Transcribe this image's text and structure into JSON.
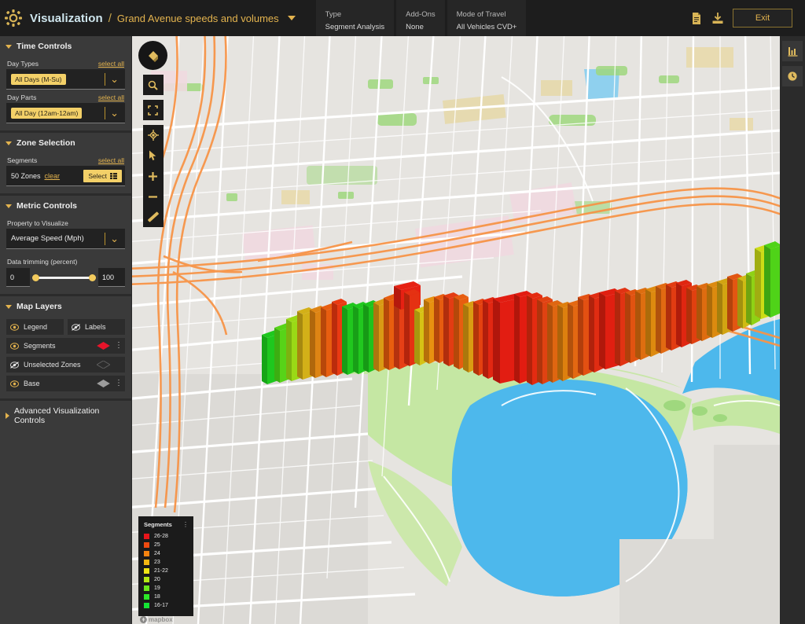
{
  "header": {
    "logo_icon": "gear-burst-logo",
    "app_title": "Visualization",
    "separator": "/",
    "project_name": "Grand Avenue speeds and volumes",
    "project_caret_icon": "chevron-down-icon",
    "chips": [
      {
        "key": "Type",
        "value": "Segment Analysis"
      },
      {
        "key": "Add-Ons",
        "value": "None"
      },
      {
        "key": "Mode of Travel",
        "value": "All Vehicles CVD+"
      }
    ],
    "report_icon": "document-icon",
    "download_icon": "download-icon",
    "exit_label": "Exit"
  },
  "sidebar": {
    "time_controls": {
      "title": "Time Controls",
      "expanded": true,
      "day_types": {
        "label": "Day Types",
        "select_all": "select all",
        "value": "All Days (M-Su)",
        "chevron_icon": "chevron-down-icon"
      },
      "day_parts": {
        "label": "Day Parts",
        "select_all": "select all",
        "value": "All Day (12am-12am)",
        "chevron_icon": "chevron-down-icon"
      }
    },
    "zone_selection": {
      "title": "Zone Selection",
      "expanded": true,
      "segments_label": "Segments",
      "select_all": "select all",
      "zone_count": "50 Zones",
      "clear_label": "clear",
      "select_button": "Select",
      "select_button_icon": "grid-icon"
    },
    "metric_controls": {
      "title": "Metric Controls",
      "expanded": true,
      "property_label": "Property to Visualize",
      "property_value": "Average Speed (Mph)",
      "chevron_icon": "chevron-down-icon",
      "trimming_label": "Data trimming (percent)",
      "trim_min": "0",
      "trim_max": "100"
    },
    "map_layers": {
      "title": "Map Layers",
      "expanded": true,
      "rows": [
        {
          "label": "Legend",
          "visible": true,
          "eye_icon": "eye-icon",
          "shape": "none",
          "menu": false
        },
        {
          "label": "Labels",
          "visible": false,
          "eye_icon": "eye-off-icon",
          "shape": "none",
          "menu": false
        },
        {
          "label": "Segments",
          "visible": true,
          "eye_icon": "eye-icon",
          "shape": "diamond",
          "shape_color": "#e8142a",
          "menu": true
        },
        {
          "label": "Unselected Zones",
          "visible": false,
          "eye_icon": "eye-off-icon",
          "shape": "diamond",
          "shape_color": "#4a4a4a",
          "menu": false
        },
        {
          "label": "Base",
          "visible": true,
          "eye_icon": "eye-icon",
          "shape": "diamond",
          "shape_color": "#9d9d9d",
          "menu": true
        }
      ]
    },
    "advanced": {
      "title": "Advanced Visualization Controls",
      "expanded": false
    }
  },
  "map": {
    "tools": [
      {
        "name": "paint-bucket-tool",
        "icon": "bucket-icon"
      },
      {
        "name": "search-tool",
        "icon": "search-icon"
      },
      {
        "name": "fullscreen-tool",
        "icon": "expand-icon"
      },
      {
        "name": "recenter-tool",
        "icon": "crosshair-icon"
      },
      {
        "name": "pointer-tool",
        "icon": "cursor-icon"
      },
      {
        "name": "zoom-in-tool",
        "icon": "plus-icon"
      },
      {
        "name": "zoom-out-tool",
        "icon": "minus-icon"
      },
      {
        "name": "measure-tool",
        "icon": "ruler-icon"
      }
    ],
    "attribution": "mapbox"
  },
  "legend": {
    "title": "Segments",
    "menu_icon": "kebab-menu-icon",
    "items": [
      {
        "label": "26-28",
        "color": "#e8151b"
      },
      {
        "label": "25",
        "color": "#f04a10"
      },
      {
        "label": "24",
        "color": "#f58410"
      },
      {
        "label": "23",
        "color": "#f6b812"
      },
      {
        "label": "21-22",
        "color": "#f0e415"
      },
      {
        "label": "20",
        "color": "#b4e815"
      },
      {
        "label": "19",
        "color": "#6ae81a"
      },
      {
        "label": "18",
        "color": "#2ce827"
      },
      {
        "label": "16-17",
        "color": "#14e234"
      }
    ]
  },
  "rail": {
    "buttons": [
      {
        "name": "chart-panel-button",
        "icon": "bar-chart-icon"
      },
      {
        "name": "history-button",
        "icon": "clock-icon"
      }
    ]
  },
  "chart_data": {
    "type": "bar",
    "title": "Average Speed (Mph) per segment",
    "legend_position": "bottom-left",
    "categories": [
      "16-17",
      "18",
      "19",
      "20",
      "21-22",
      "23",
      "24",
      "25",
      "26-28"
    ],
    "values": [
      20,
      18,
      19,
      23,
      26,
      24,
      25,
      27,
      28,
      27,
      24,
      22,
      21,
      20,
      26,
      27,
      28,
      27,
      26,
      25,
      24,
      22,
      20,
      18,
      26,
      27,
      28,
      27,
      26,
      25,
      24,
      23,
      22,
      21,
      20,
      19,
      18,
      26,
      27,
      28,
      27,
      26,
      25,
      24,
      23,
      22,
      21,
      20,
      19,
      17
    ],
    "ylabel": "Average Speed (Mph)",
    "xlabel": "Segment"
  }
}
